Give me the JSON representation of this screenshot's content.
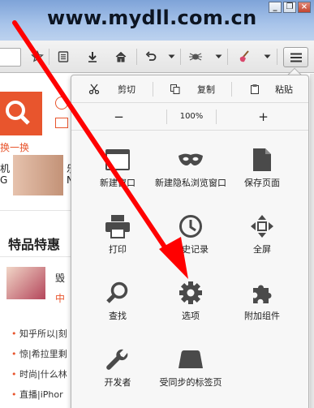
{
  "watermark": "www.mydll.com.cn",
  "window_controls": {
    "minimize": "_",
    "restore": "❐",
    "close": "×"
  },
  "edit_row": {
    "cut": "剪切",
    "copy": "复制",
    "paste": "粘贴"
  },
  "zoom_row": {
    "zoom_out": "−",
    "zoom_level": "100%",
    "zoom_in": "+"
  },
  "menu_items": [
    {
      "label": "新建窗口",
      "icon": "new-window-icon"
    },
    {
      "label": "新建隐私浏览窗口",
      "icon": "private-mask-icon"
    },
    {
      "label": "保存页面",
      "icon": "save-page-icon"
    },
    {
      "label": "打印",
      "icon": "print-icon"
    },
    {
      "label": "历史记录",
      "icon": "history-icon"
    },
    {
      "label": "全屏",
      "icon": "fullscreen-icon"
    },
    {
      "label": "查找",
      "icon": "search-icon"
    },
    {
      "label": "选项",
      "icon": "gear-icon"
    },
    {
      "label": "附加组件",
      "icon": "puzzle-icon"
    },
    {
      "label": "开发者",
      "icon": "wrench-icon"
    },
    {
      "label": "受同步的标签页",
      "icon": "synced-tabs-icon"
    }
  ],
  "page_bg": {
    "link_text": "换一换",
    "section_title": "特品特惠",
    "item_a": "毁",
    "item_b": "中",
    "list": [
      "知乎所以|刻",
      "惊|希拉里剩",
      "时尚|什么林",
      "直播|iPhor"
    ],
    "left_labels": [
      "机",
      "G"
    ],
    "right_labels": [
      "乐",
      "N"
    ]
  },
  "colors": {
    "accent": "#e23b1a",
    "arrow": "#ff0000",
    "titlebar": "#8fb0e0"
  }
}
